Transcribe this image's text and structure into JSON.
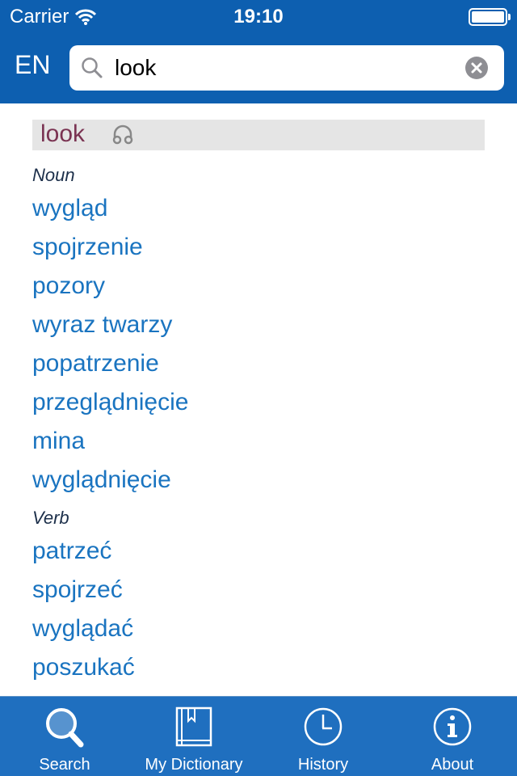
{
  "status": {
    "carrier": "Carrier",
    "time": "19:10"
  },
  "search": {
    "lang": "EN",
    "value": "look"
  },
  "entry": {
    "headword": "look",
    "noun_label": "Noun",
    "nouns": [
      "wygląd",
      "spojrzenie",
      "pozory",
      "wyraz twarzy",
      "popatrzenie",
      "przeglądnięcie",
      "mina",
      "wyglądnięcie"
    ],
    "verb_label": "Verb",
    "verbs": [
      "patrzeć",
      "spojrzeć",
      "wyglądać",
      "poszukać"
    ]
  },
  "tabs": [
    {
      "label": "Search",
      "icon": "magnifier-icon"
    },
    {
      "label": "My Dictionary",
      "icon": "book-icon"
    },
    {
      "label": "History",
      "icon": "clock-icon"
    },
    {
      "label": "About",
      "icon": "info-icon"
    }
  ],
  "colors": {
    "bar": "#0d5fb0",
    "tabbar": "#1f6fbf",
    "translation": "#1a74c0",
    "headword": "#7a3352"
  }
}
